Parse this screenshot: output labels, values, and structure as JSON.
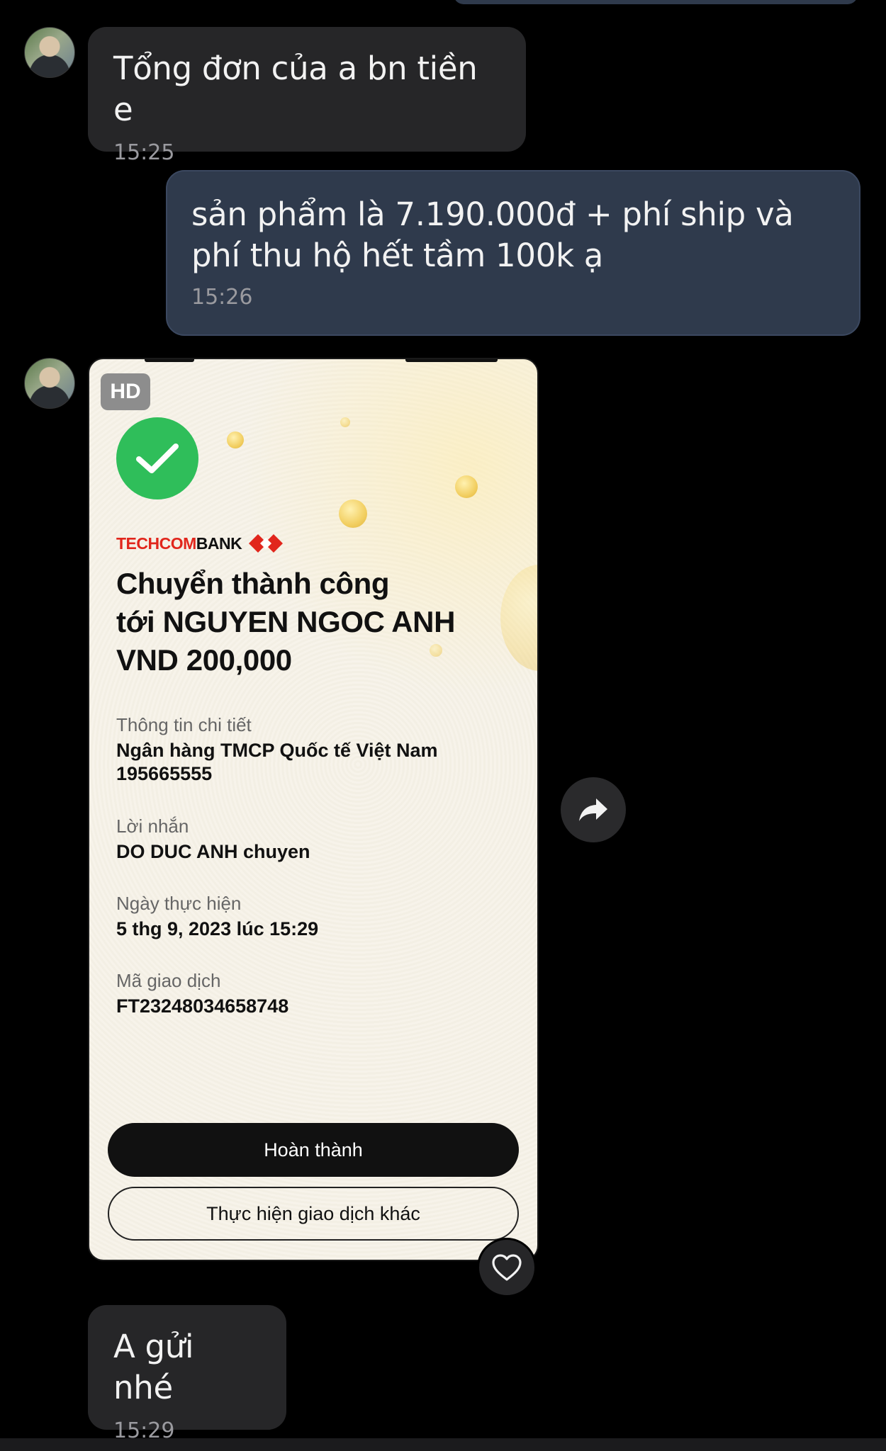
{
  "messages": [
    {
      "from": "other",
      "text": "Tổng đơn của a bn tiền e",
      "time": "15:25"
    },
    {
      "from": "me",
      "text": "sản phẩm là 7.190.000đ + phí ship và phí thu hộ hết tầm 100k ạ",
      "time": "15:26"
    },
    {
      "from": "other",
      "text": "A gửi nhé",
      "time": "15:29"
    }
  ],
  "image_card": {
    "badge": "HD",
    "brand_part1": "TECHCOM",
    "brand_part2": "BANK",
    "title_line1": "Chuyển thành công",
    "title_line2": "tới NGUYEN NGOC ANH",
    "title_line3": "VND 200,000",
    "details_heading": "Thông tin chi tiết",
    "bank_name": "Ngân hàng TMCP Quốc tế Việt Nam",
    "account_number": "195665555",
    "message_label": "Lời nhắn",
    "message_value": "DO DUC ANH chuyen",
    "date_label": "Ngày thực hiện",
    "date_value": "5 thg 9, 2023 lúc 15:29",
    "txn_label": "Mã giao dịch",
    "txn_value": "FT23248034658748",
    "primary_button": "Hoàn thành",
    "secondary_button": "Thực hiện giao dịch khác"
  },
  "icons": {
    "share": "share-arrow-icon",
    "heart": "heart-icon",
    "success": "checkmark-icon"
  },
  "colors": {
    "background": "#000000",
    "incoming_bubble": "#262628",
    "outgoing_bubble": "#2f3a4c",
    "success_green": "#2fbe5a",
    "brand_red": "#e1261c"
  }
}
